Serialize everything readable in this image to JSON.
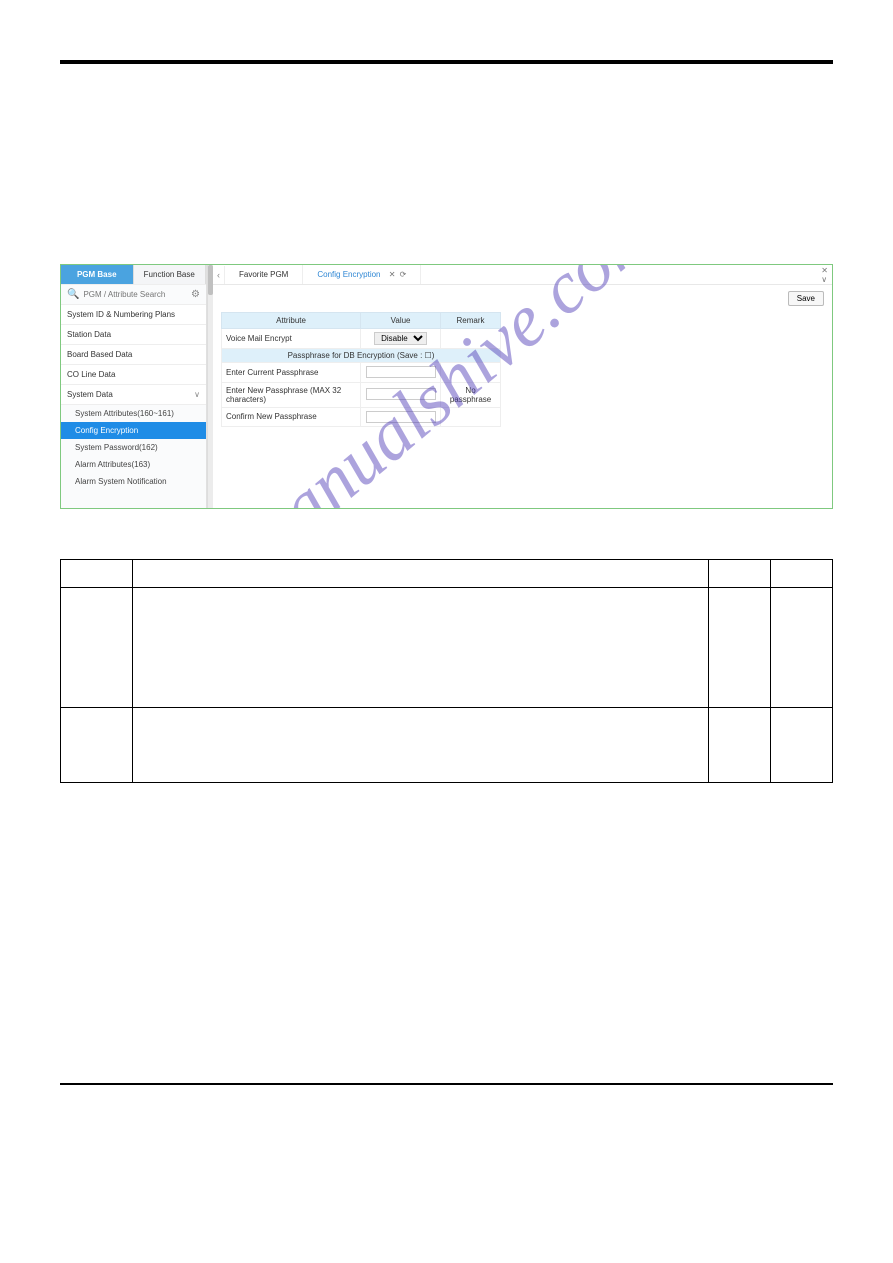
{
  "watermark": "manualshive.com",
  "sidebar": {
    "tabs": {
      "pgm": "PGM Base",
      "function": "Function Base"
    },
    "search": {
      "placeholder": "PGM / Attribute Search"
    },
    "items": [
      "System ID & Numbering Plans",
      "Station Data",
      "Board Based Data",
      "CO Line Data",
      "System Data"
    ],
    "subitems": [
      "System Attributes(160~161)",
      "Config Encryption",
      "System Password(162)",
      "Alarm Attributes(163)",
      "Alarm System Notification"
    ]
  },
  "maintabs": {
    "favorite": "Favorite PGM",
    "config": "Config Encryption",
    "close": "✕",
    "reload": "⟳"
  },
  "save_label": "Save",
  "attr_table": {
    "headers": {
      "attribute": "Attribute",
      "value": "Value",
      "remark": "Remark"
    },
    "row1": {
      "label": "Voice Mail Encrypt",
      "value": "Disable"
    },
    "section": "Passphrase for DB Encryption (Save : ☐)",
    "row2": "Enter Current Passphrase",
    "row3": "Enter New Passphrase (MAX 32 characters)",
    "row4": "Confirm New Passphrase",
    "remark3": "No passphrase"
  },
  "outer_table": {
    "headers": [
      "",
      "",
      "",
      ""
    ],
    "rows": [
      {
        "c1": "",
        "c2": "",
        "c3": "",
        "c4": ""
      },
      {
        "c1": "",
        "c2": "",
        "c3": "",
        "c4": ""
      }
    ]
  }
}
